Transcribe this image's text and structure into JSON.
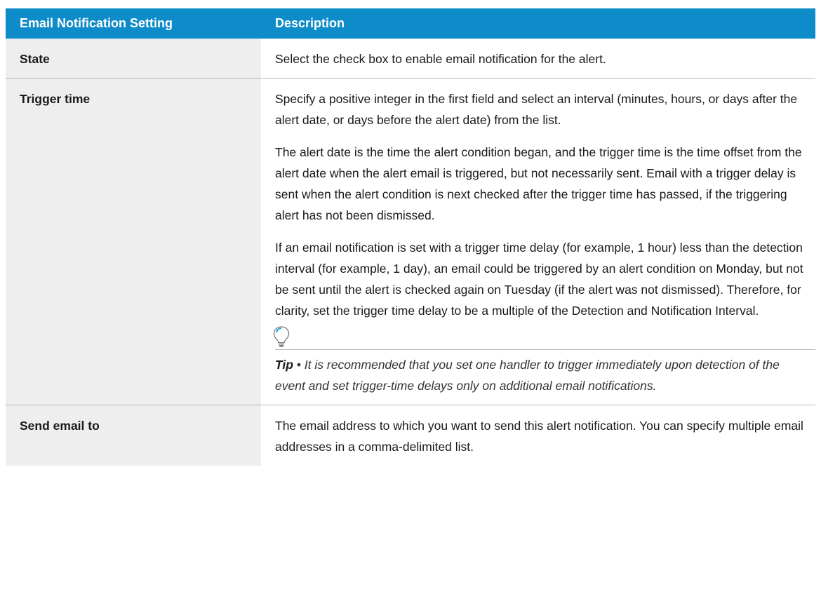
{
  "table": {
    "headers": {
      "setting": "Email Notification Setting",
      "description": "Description"
    },
    "rows": [
      {
        "setting": "State",
        "paragraphs": [
          "Select the check box to enable email notification for the alert."
        ]
      },
      {
        "setting": "Trigger time",
        "paragraphs": [
          "Specify a positive integer in the first field and select an interval (minutes, hours, or days after the alert date, or days before the alert date) from the list.",
          "The alert date is the time the alert condition began, and the trigger time is the time offset from the alert date when the alert email is triggered, but not necessarily sent. Email with a trigger delay is sent when the alert condition is next checked after the trigger time has passed, if the triggering alert has not been dismissed.",
          "If an email notification is set with a trigger time delay (for example, 1 hour) less than the detection interval (for example, 1 day), an email could be triggered by an alert condition on Monday, but not be sent until the alert is checked again on Tuesday (if the alert was not dismissed). Therefore, for clarity, set the trigger time delay to be a multiple of the Detection and Notification Interval."
        ],
        "tip": {
          "icon": "lightbulb-icon",
          "label": "Tip",
          "separator": " • ",
          "text": "It is recommended that you set one handler to trigger immediately upon detection of the event and set trigger-time delays only on additional email notifications."
        }
      },
      {
        "setting": "Send email to",
        "paragraphs": [
          "The email address to which you want to send this alert notification. You can specify multiple email addresses in a comma-delimited list."
        ]
      }
    ]
  },
  "colors": {
    "header_background": "#0e8bc9",
    "header_text": "#ffffff",
    "setting_column_background": "#eeeeee",
    "row_divider": "#b9b9b9",
    "tip_icon_accent": "#29a9e0"
  }
}
